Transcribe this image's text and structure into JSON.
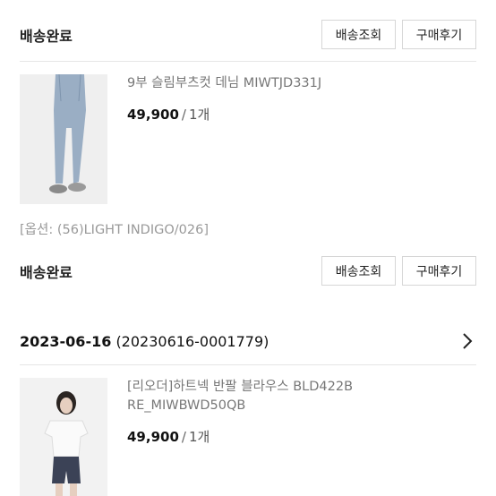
{
  "order1": {
    "items": [
      {
        "status": "배송완료",
        "track_label": "배송조회",
        "review_label": "구매후기"
      },
      {
        "name": "9부 슬림부츠컷 데님 MIWTJD331J",
        "price": "49,900",
        "slash": "/",
        "qty": "1개",
        "option": "[옵션: (56)LIGHT INDIGO/026]",
        "status": "배송완료",
        "track_label": "배송조회",
        "review_label": "구매후기"
      }
    ]
  },
  "order2": {
    "date": "2023-06-16",
    "order_no": "(20230616-0001779)",
    "item": {
      "name_line1": "[리오더]하트넥 반팔 블라우스 BLD422B",
      "name_line2": "RE_MIWBWD50QB",
      "price": "49,900",
      "slash": "/",
      "qty": "1개"
    }
  },
  "colors": {
    "accent_text": "#222222",
    "muted": "#777777",
    "border": "#d6d6d6"
  }
}
